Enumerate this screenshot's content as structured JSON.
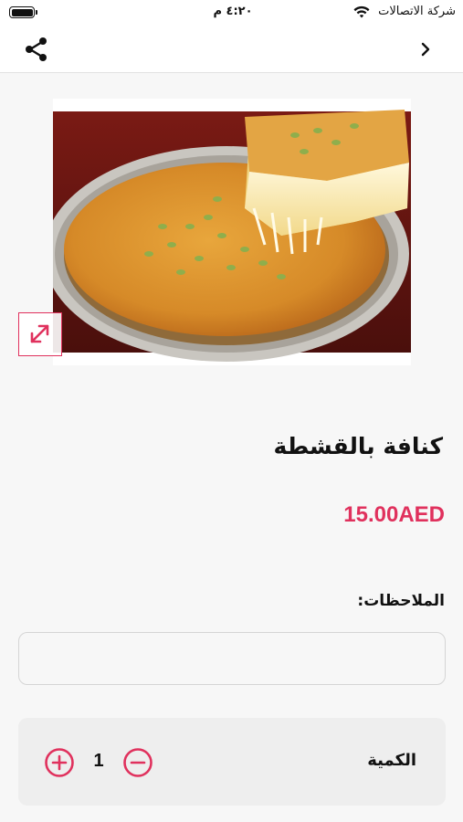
{
  "status_bar": {
    "carrier": "شركة الاتصالات",
    "time": "٤:٢٠ م",
    "wifi_icon": "wifi-icon",
    "battery_icon": "battery-icon"
  },
  "nav": {
    "share_icon": "share-icon",
    "back_icon": "chevron-right-icon"
  },
  "product": {
    "image": "kunafa-with-cream-photo",
    "expand_icon": "expand-arrows-icon",
    "title": "كنافة بالقشطة",
    "price": "15.00AED"
  },
  "notes": {
    "label": "الملاحظات:",
    "value": "",
    "placeholder": ""
  },
  "quantity": {
    "label": "الكمية",
    "value": "1",
    "increase_icon": "plus-circle-icon",
    "decrease_icon": "minus-circle-icon"
  },
  "colors": {
    "accent": "#e0315d",
    "background": "#f7f7f7",
    "card": "#eeeeee"
  }
}
